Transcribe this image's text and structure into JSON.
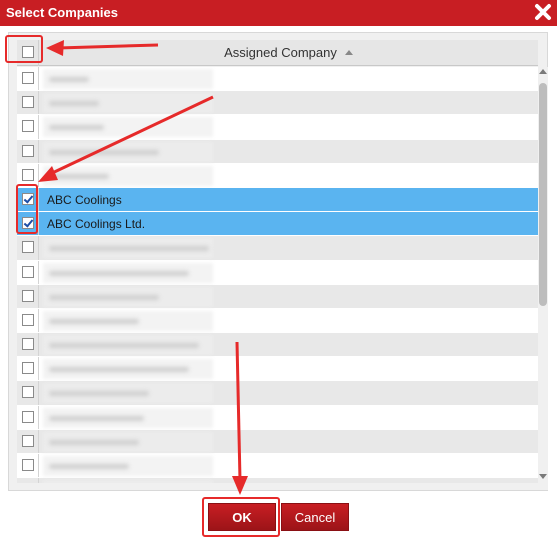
{
  "dialog": {
    "title": "Select Companies",
    "close_icon": "close-icon"
  },
  "grid": {
    "header": {
      "column_title": "Assigned Company",
      "sort_icon": "sort-ascending-icon",
      "select_all_checked": false
    },
    "rows": [
      {
        "name": "",
        "checked": false,
        "selected": false,
        "blurred": true
      },
      {
        "name": "",
        "checked": false,
        "selected": false,
        "blurred": true
      },
      {
        "name": "",
        "checked": false,
        "selected": false,
        "blurred": true
      },
      {
        "name": "",
        "checked": false,
        "selected": false,
        "blurred": true
      },
      {
        "name": "",
        "checked": false,
        "selected": false,
        "blurred": true
      },
      {
        "name": "ABC Coolings",
        "checked": true,
        "selected": true,
        "blurred": false
      },
      {
        "name": "ABC Coolings Ltd.",
        "checked": true,
        "selected": true,
        "blurred": false
      },
      {
        "name": "",
        "checked": false,
        "selected": false,
        "blurred": true
      },
      {
        "name": "",
        "checked": false,
        "selected": false,
        "blurred": true
      },
      {
        "name": "",
        "checked": false,
        "selected": false,
        "blurred": true
      },
      {
        "name": "",
        "checked": false,
        "selected": false,
        "blurred": true
      },
      {
        "name": "",
        "checked": false,
        "selected": false,
        "blurred": true
      },
      {
        "name": "",
        "checked": false,
        "selected": false,
        "blurred": true
      },
      {
        "name": "",
        "checked": false,
        "selected": false,
        "blurred": true
      },
      {
        "name": "",
        "checked": false,
        "selected": false,
        "blurred": true
      },
      {
        "name": "",
        "checked": false,
        "selected": false,
        "blurred": true
      },
      {
        "name": "",
        "checked": false,
        "selected": false,
        "blurred": true
      },
      {
        "name": "",
        "checked": false,
        "selected": false,
        "blurred": true
      }
    ]
  },
  "buttons": {
    "ok_label": "OK",
    "cancel_label": "Cancel"
  },
  "colors": {
    "brand_red": "#c81e23",
    "selection_blue": "#5ab4f0",
    "annotation_red": "#e62a2a"
  }
}
